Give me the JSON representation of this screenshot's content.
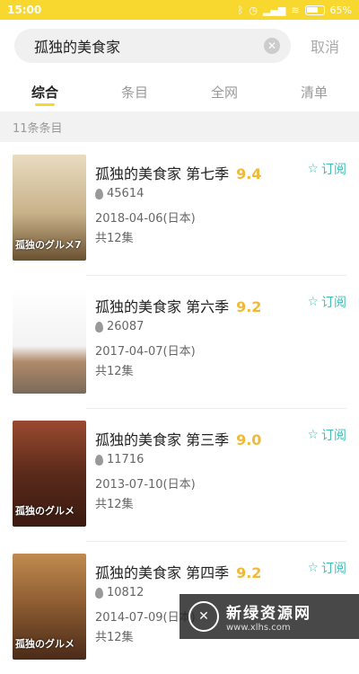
{
  "status_bar": {
    "time": "15:00",
    "battery": "65%",
    "icons": [
      "bluetooth-icon",
      "alarm-icon",
      "signal-icon",
      "wifi-icon",
      "battery-icon"
    ]
  },
  "search": {
    "query": "孤独的美食家",
    "clear_icon": "close-icon",
    "cancel_label": "取消"
  },
  "tabs": [
    {
      "label": "综合",
      "active": true
    },
    {
      "label": "条目",
      "active": false
    },
    {
      "label": "全网",
      "active": false
    },
    {
      "label": "清单",
      "active": false
    }
  ],
  "result_count": "11条条目",
  "items": [
    {
      "title": "孤独的美食家 第七季",
      "score": "9.4",
      "hot": "45614",
      "date": "2018-04-06(日本)",
      "episodes": "共12集",
      "subscribe": "订阅",
      "poster_color": "#c9b28a",
      "poster_text": "孤独のグルメ7"
    },
    {
      "title": "孤独的美食家 第六季",
      "score": "9.2",
      "hot": "26087",
      "date": "2017-04-07(日本)",
      "episodes": "共12集",
      "subscribe": "订阅",
      "poster_color": "#f3f3f3",
      "poster_text": ""
    },
    {
      "title": "孤独的美食家 第三季",
      "score": "9.0",
      "hot": "11716",
      "date": "2013-07-10(日本)",
      "episodes": "共12集",
      "subscribe": "订阅",
      "poster_color": "#7a3a2a",
      "poster_text": "孤独のグルメ"
    },
    {
      "title": "孤独的美食家 第四季",
      "score": "9.2",
      "hot": "10812",
      "date": "2014-07-09(日本)",
      "episodes": "共12集",
      "subscribe": "订阅",
      "poster_color": "#8a5a30",
      "poster_text": "孤独のグルメ"
    }
  ],
  "watermark": {
    "name": "新绿资源网",
    "url": "www.xlhs.com"
  },
  "colors": {
    "accent": "#f8d82e",
    "score": "#f0b93a",
    "subscribe": "#3cbfb5"
  }
}
